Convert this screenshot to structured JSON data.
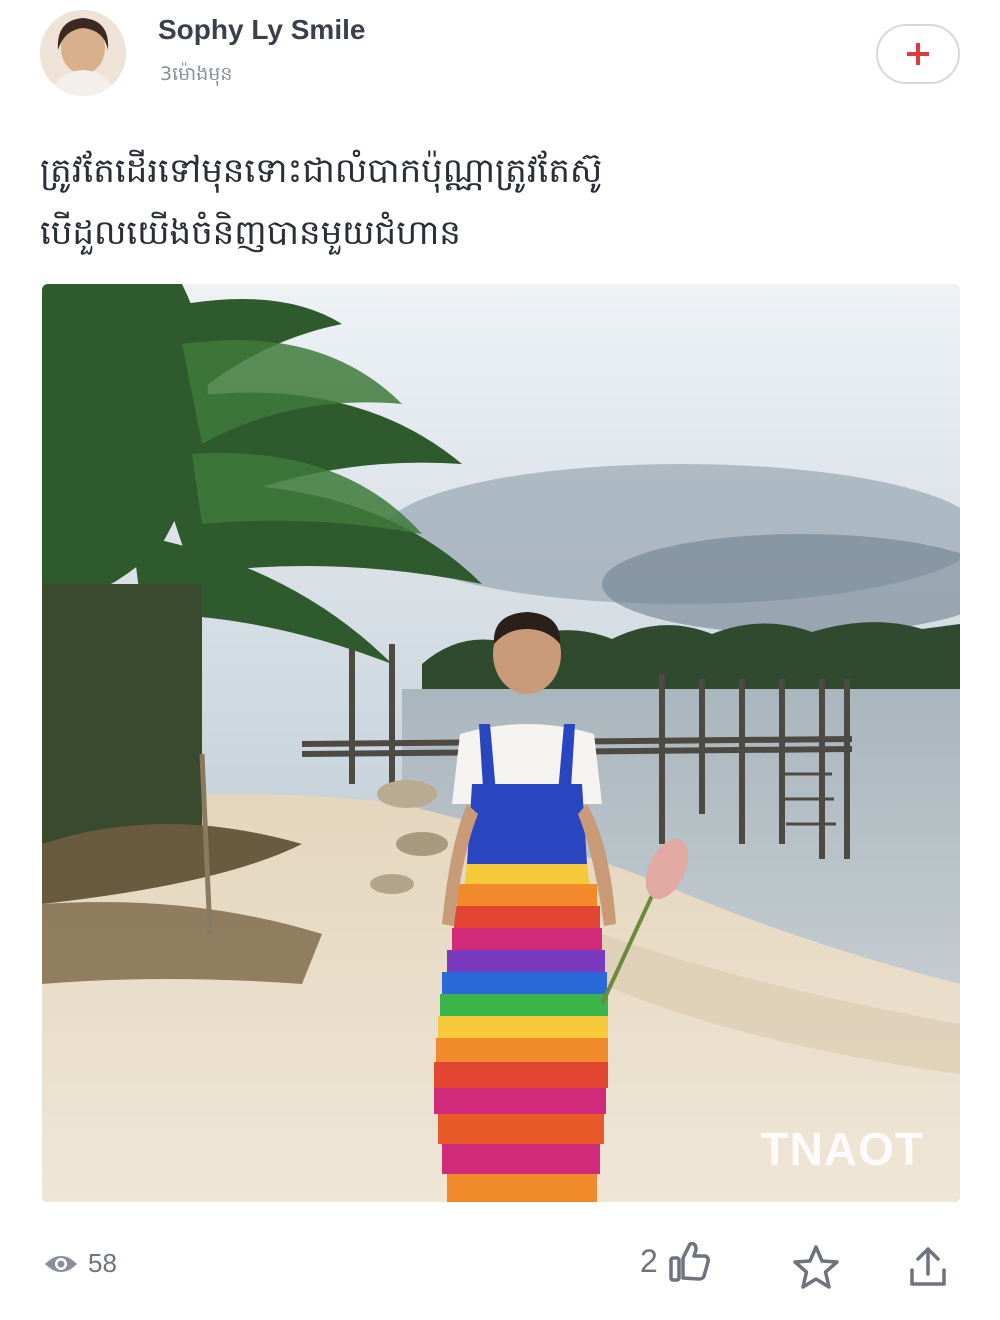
{
  "author": {
    "name": "Sophy Ly Smile",
    "time": "3ម៉ោងមុន"
  },
  "caption": {
    "line1": "ត្រូវតែដើរទៅមុនទោះជាលំបាកប៉ុណ្ណាត្រូវតែស៊ូ",
    "line2": "បើដួលយើងចំនិញបានមួយជំហាន"
  },
  "photo": {
    "watermark": "TNAOT"
  },
  "stats": {
    "views": "58",
    "likes": "2"
  },
  "icons": {
    "follow": "plus-icon",
    "views": "eye-icon",
    "like": "thumbs-up-icon",
    "favorite": "star-icon",
    "share": "share-icon"
  },
  "colors": {
    "accent": "#e03a3a",
    "icon": "#6e737c"
  }
}
